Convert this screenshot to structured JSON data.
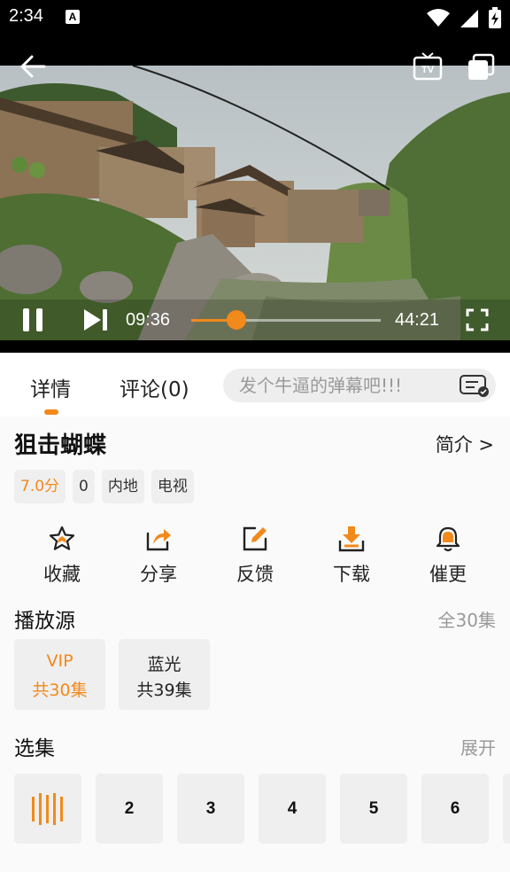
{
  "status_bar": {
    "time": "2:34",
    "notification_letter": "A"
  },
  "player": {
    "current_time": "09:36",
    "duration": "44:21",
    "progress_fraction": 0.24,
    "tv_label": "TV"
  },
  "tabs": {
    "details": "详情",
    "comments": "评论(0)"
  },
  "danmaku": {
    "placeholder": "发个牛逼的弹幕吧!!!"
  },
  "show": {
    "title": "狙击蝴蝶",
    "intro_link": "简介 >",
    "tags": [
      "7.0分",
      "0",
      "内地",
      "电视"
    ]
  },
  "actions": [
    {
      "label": "收藏",
      "icon": "star-icon"
    },
    {
      "label": "分享",
      "icon": "share-icon"
    },
    {
      "label": "反馈",
      "icon": "edit-icon"
    },
    {
      "label": "下载",
      "icon": "download-icon"
    },
    {
      "label": "催更",
      "icon": "bell-icon"
    }
  ],
  "sources": {
    "title": "播放源",
    "total": "全30集",
    "items": [
      {
        "name": "VIP",
        "count": "共30集",
        "active": true
      },
      {
        "name": "蓝光",
        "count": "共39集",
        "active": false
      }
    ]
  },
  "episodes": {
    "title": "选集",
    "expand": "展开",
    "items": [
      "2",
      "3",
      "4",
      "5",
      "6"
    ]
  },
  "colors": {
    "accent": "#f2891b",
    "chip_bg": "#efefef",
    "muted": "#9a9a9a"
  }
}
